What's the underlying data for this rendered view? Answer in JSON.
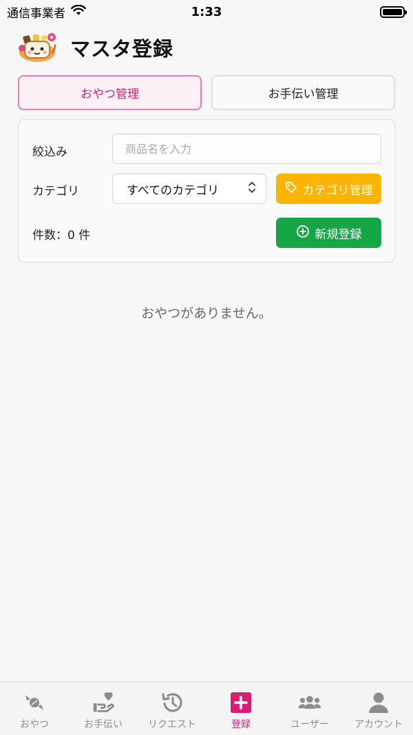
{
  "status_bar": {
    "carrier": "通信事業者",
    "time": "1:33"
  },
  "header": {
    "title": "マスタ登録",
    "logo_icon": "snack-mascot-logo"
  },
  "tabs": [
    {
      "label": "おやつ管理",
      "active": true
    },
    {
      "label": "お手伝い管理",
      "active": false
    }
  ],
  "filter": {
    "search_label": "絞込み",
    "search_placeholder": "商品名を入力",
    "search_value": "",
    "category_label": "カテゴリ",
    "category_selected": "すべてのカテゴリ",
    "category_manage_label": "カテゴリ管理",
    "count_text": "件数：0 件",
    "new_button_label": "新規登録"
  },
  "empty_message": "おやつがありません。",
  "bottom_nav": [
    {
      "label": "おやつ",
      "icon": "candy-icon",
      "active": false
    },
    {
      "label": "お手伝い",
      "icon": "hand-heart-icon",
      "active": false
    },
    {
      "label": "リクエスト",
      "icon": "history-icon",
      "active": false
    },
    {
      "label": "登録",
      "icon": "plus-square-icon",
      "active": true
    },
    {
      "label": "ユーザー",
      "icon": "users-icon",
      "active": false
    },
    {
      "label": "アカウント",
      "icon": "person-icon",
      "active": false
    }
  ],
  "colors": {
    "accent_pink": "#d61f72",
    "tab_border_pink": "#f279b2",
    "category_button": "#fbb400",
    "new_button": "#16a645",
    "nav_inactive": "#8c8c8c"
  }
}
